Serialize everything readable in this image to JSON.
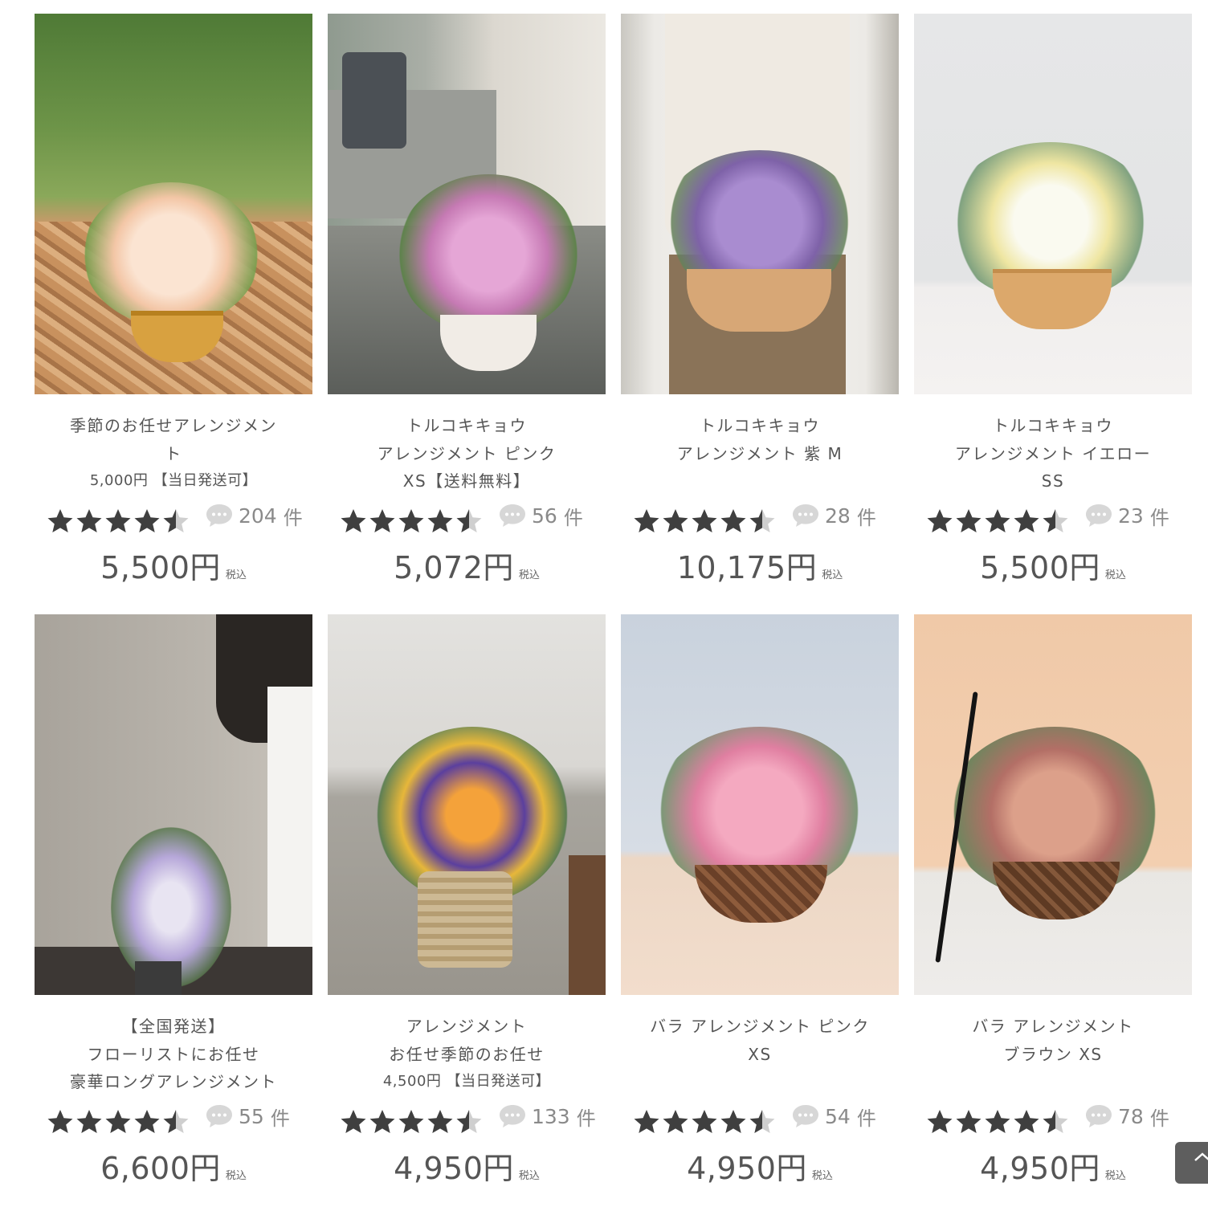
{
  "products": [
    {
      "image_alt": "季節のお任せアレンジメント",
      "title_lines": [
        "季節のお任せアレンジメン",
        "ト",
        "5,000円 【当日発送可】"
      ],
      "rating": 4.5,
      "review_count": "204",
      "review_unit": "件",
      "price": "5,500円",
      "tax_label": "税込"
    },
    {
      "image_alt": "トルコキキョウ アレンジメント ピンク XS",
      "title_lines": [
        "トルコキキョウ",
        "アレンジメント ピンク",
        "XS【送料無料】"
      ],
      "rating": 4.5,
      "review_count": "56",
      "review_unit": "件",
      "price": "5,072円",
      "tax_label": "税込"
    },
    {
      "image_alt": "トルコキキョウ アレンジメント 紫 M",
      "title_lines": [
        "トルコキキョウ",
        "アレンジメント 紫 M",
        ""
      ],
      "rating": 4.5,
      "review_count": "28",
      "review_unit": "件",
      "price": "10,175円",
      "tax_label": "税込"
    },
    {
      "image_alt": "トルコキキョウ アレンジメント イエロー SS",
      "title_lines": [
        "トルコキキョウ",
        "アレンジメント イエロー",
        "SS"
      ],
      "rating": 4.5,
      "review_count": "23",
      "review_unit": "件",
      "price": "5,500円",
      "tax_label": "税込"
    },
    {
      "image_alt": "フローリストにお任せ 豪華ロングアレンジメント",
      "title_lines": [
        "【全国発送】",
        "フローリストにお任せ",
        "豪華ロングアレンジメント"
      ],
      "rating": 4.5,
      "review_count": "55",
      "review_unit": "件",
      "price": "6,600円",
      "tax_label": "税込"
    },
    {
      "image_alt": "アレンジメント お任せ季節のお任せ",
      "title_lines": [
        "アレンジメント",
        "お任せ季節のお任せ",
        "4,500円 【当日発送可】"
      ],
      "rating": 4.5,
      "review_count": "133",
      "review_unit": "件",
      "price": "4,950円",
      "tax_label": "税込"
    },
    {
      "image_alt": "バラ アレンジメント ピンク XS",
      "title_lines": [
        "バラ アレンジメント ピンク",
        "XS",
        ""
      ],
      "rating": 4.5,
      "review_count": "54",
      "review_unit": "件",
      "price": "4,950円",
      "tax_label": "税込"
    },
    {
      "image_alt": "バラ アレンジメント ブラウン XS",
      "title_lines": [
        "バラ アレンジメント",
        "ブラウン XS",
        ""
      ],
      "rating": 4.5,
      "review_count": "78",
      "review_unit": "件",
      "price": "4,950円",
      "tax_label": "税込"
    }
  ],
  "icons": {
    "star": "star-icon",
    "review": "speech-bubble-icon",
    "back_to_top": "chevron-up-icon"
  },
  "colors": {
    "star": "#3f3f3f",
    "star_empty": "#cfcfcf",
    "bubble": "#d7d7d7",
    "text": "#555555",
    "back_to_top": "#5e5e5e"
  }
}
